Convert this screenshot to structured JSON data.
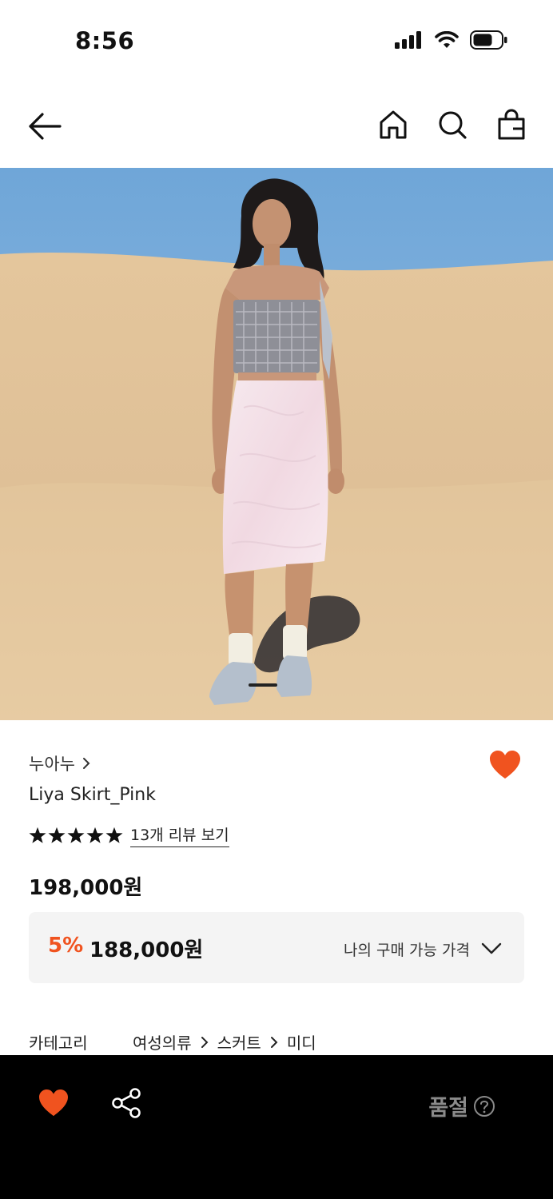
{
  "status_bar": {
    "time": "8:56"
  },
  "nav": {
    "icons": [
      "back-arrow-icon",
      "home-icon",
      "search-icon",
      "shopping-bag-icon"
    ]
  },
  "hero": {
    "image": "model-in-desert-wearing-pink-skirt",
    "slide_index": 1
  },
  "product": {
    "brand": "누아누",
    "name": "Liya Skirt_Pink",
    "rating_stars": 5,
    "review_link": "13개 리뷰 보기",
    "price": "198,000원",
    "wishlisted": true
  },
  "discount": {
    "rate": "5%",
    "price": "188,000원",
    "my_price_label": "나의 구매 가능 가격"
  },
  "category": {
    "label": "카테고리",
    "path": [
      "여성의류",
      "스커트",
      "미디"
    ]
  },
  "bottom_bar": {
    "status": "품절",
    "colors": {
      "accent": "#f0531f",
      "bar": "#000000",
      "status_text": "#8a8a8a"
    }
  }
}
